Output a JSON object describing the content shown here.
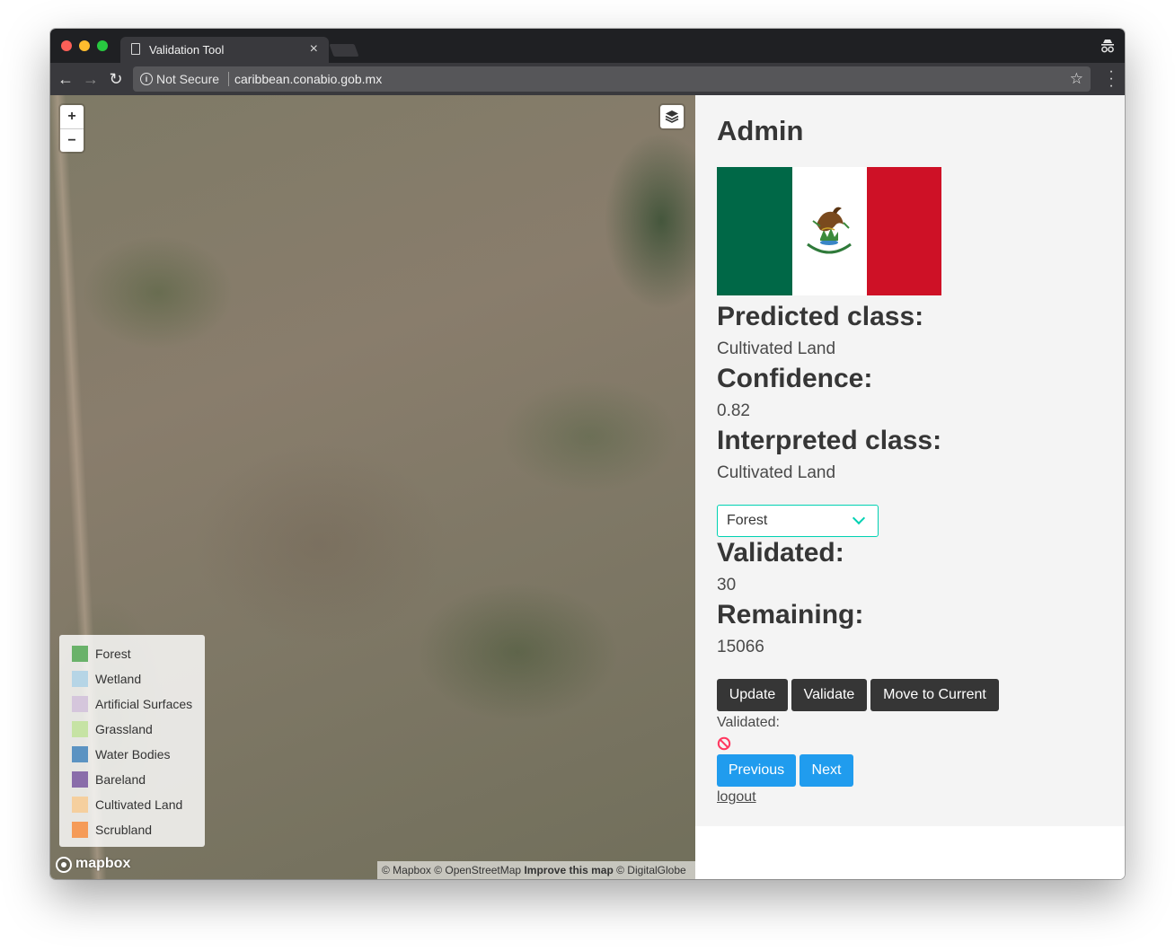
{
  "browser": {
    "tab_title": "Validation Tool",
    "tab_close": "×",
    "security_label": "Not Secure",
    "url": "caribbean.conabio.gob.mx",
    "star": "☆"
  },
  "map": {
    "zoom_in": "+",
    "zoom_out": "−",
    "legend": [
      {
        "label": "Forest",
        "color": "#6ab26a"
      },
      {
        "label": "Wetland",
        "color": "#b6d5e6"
      },
      {
        "label": "Artificial Surfaces",
        "color": "#d5c6dc"
      },
      {
        "label": "Grassland",
        "color": "#c6e3a4"
      },
      {
        "label": "Water Bodies",
        "color": "#5b93c2"
      },
      {
        "label": "Bareland",
        "color": "#8a6daa"
      },
      {
        "label": "Cultivated Land",
        "color": "#f5cf9e"
      },
      {
        "label": "Scrubland",
        "color": "#f59b58"
      }
    ],
    "mapbox_logo": "mapbox",
    "attribution": {
      "part1": "© Mapbox © OpenStreetMap ",
      "improve": "Improve this map",
      "part2": " © DigitalGlobe"
    }
  },
  "panel": {
    "user": "Admin",
    "predicted_label": "Predicted class:",
    "predicted_value": "Cultivated Land",
    "confidence_label": "Confidence:",
    "confidence_value": "0.82",
    "interpreted_label": "Interpreted class:",
    "interpreted_value": "Cultivated Land",
    "class_select": "Forest",
    "validated_label": "Validated:",
    "validated_value": "30",
    "remaining_label": "Remaining:",
    "remaining_value": "15066",
    "buttons": {
      "update": "Update",
      "validate": "Validate",
      "move": "Move to Current",
      "previous": "Previous",
      "next": "Next"
    },
    "validated_status_label": "Validated:",
    "logout": "logout"
  },
  "colors": {
    "accent_primary": "#00d1b2",
    "button_dark": "#363636",
    "button_blue": "#209cee",
    "status_ban": "#ff3860"
  }
}
